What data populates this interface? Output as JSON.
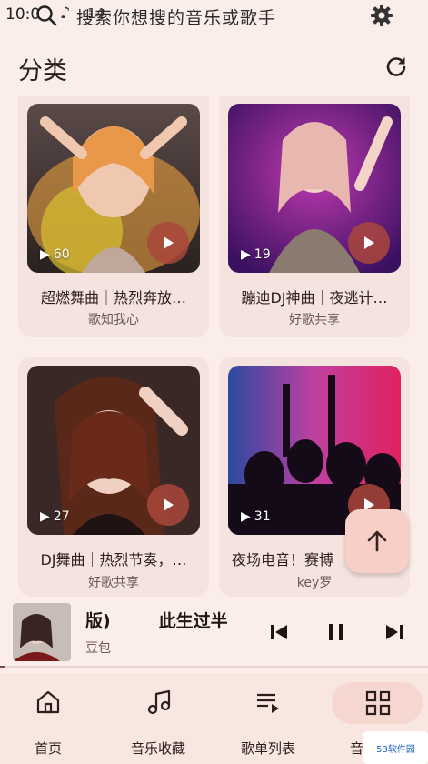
{
  "status_bar": {
    "time": "10:0",
    "note_glyph": "♪",
    "signal": "14"
  },
  "search": {
    "placeholder": "搜索你想搜的音乐或歌手"
  },
  "header": {
    "title": "分类"
  },
  "cards": [
    {
      "title": "超燃舞曲｜热烈奔放…",
      "author": "歌知我心",
      "count": "60"
    },
    {
      "title": "蹦迪DJ神曲｜夜逃计…",
      "author": "好歌共享",
      "count": "19"
    },
    {
      "title": "DJ舞曲｜热烈节奏，…",
      "author": "好歌共享",
      "count": "27"
    },
    {
      "title": "夜场电音！赛博",
      "author": "key罗",
      "count": "31"
    }
  ],
  "player": {
    "title": "版)        此生过半",
    "artist": "豆包",
    "progress": 0.01
  },
  "nav": [
    {
      "label": "首页",
      "icon": "home-icon"
    },
    {
      "label": "音乐收藏",
      "icon": "music-note-icon"
    },
    {
      "label": "歌单列表",
      "icon": "playlist-icon"
    },
    {
      "label": "音",
      "icon": "grid-icon"
    }
  ],
  "watermark": {
    "text": "53软件园"
  },
  "colors": {
    "background": "#fbeeea",
    "card": "#f5e3df",
    "accent": "#aa463c",
    "nav": "#f8e6e1"
  }
}
